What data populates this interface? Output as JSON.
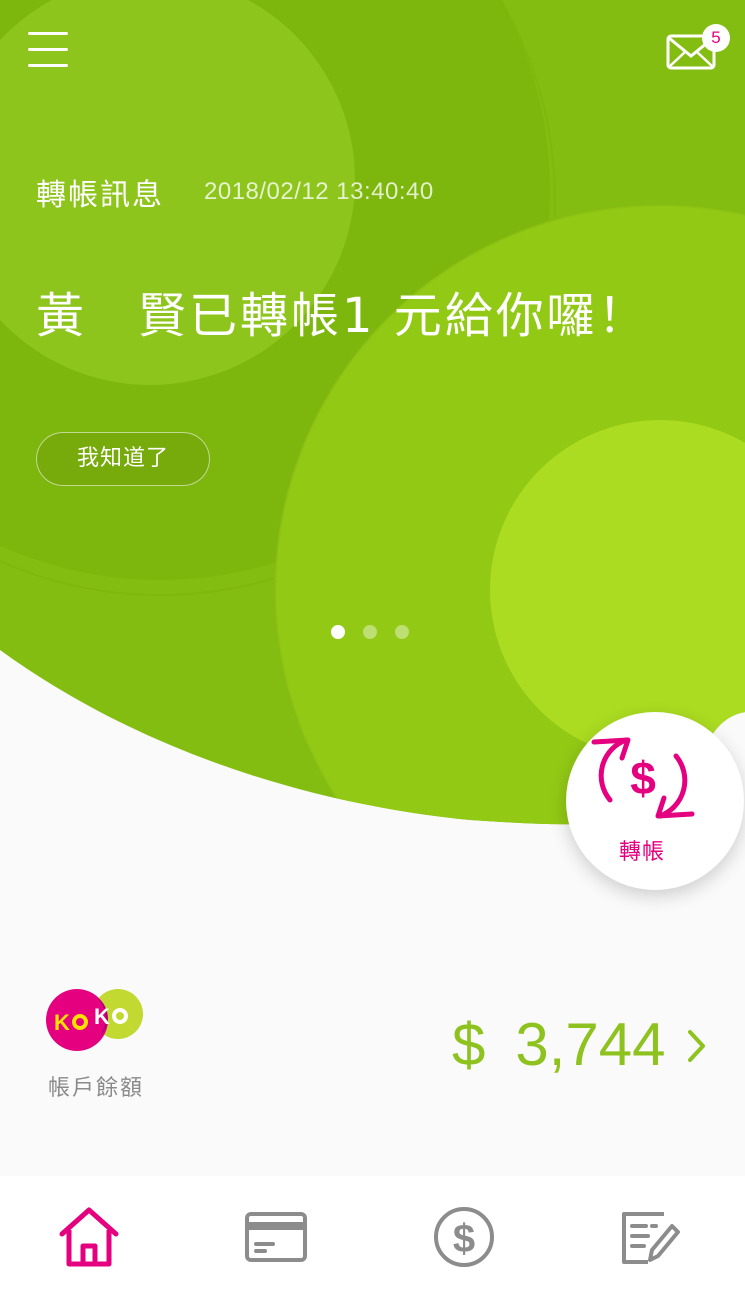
{
  "header": {
    "menu_icon": "hamburger-menu-icon",
    "mail_icon": "envelope-icon",
    "mail_badge_count": "5"
  },
  "message": {
    "title": "轉帳訊息",
    "timestamp": "2018/02/12 13:40:40",
    "body": "黃　賢已轉帳1 元給你囉！",
    "ack_label": "我知道了"
  },
  "carousel": {
    "page_count": 3,
    "active_index": 0
  },
  "transfer": {
    "label": "轉帳",
    "icon": "dollar-refresh-icon"
  },
  "balance": {
    "logo_text": "KOKO",
    "label": "帳戶餘額",
    "currency": "$",
    "amount": "3,744"
  },
  "tabbar": {
    "items": [
      {
        "icon": "home-icon",
        "active": true
      },
      {
        "icon": "credit-card-icon",
        "active": false
      },
      {
        "icon": "dollar-circle-icon",
        "active": false
      },
      {
        "icon": "edit-document-icon",
        "active": false
      }
    ]
  },
  "colors": {
    "accent": "#e4007f",
    "green": "#8dc21f",
    "hero_green": "#84be10",
    "inactive": "#8c8c8c"
  }
}
